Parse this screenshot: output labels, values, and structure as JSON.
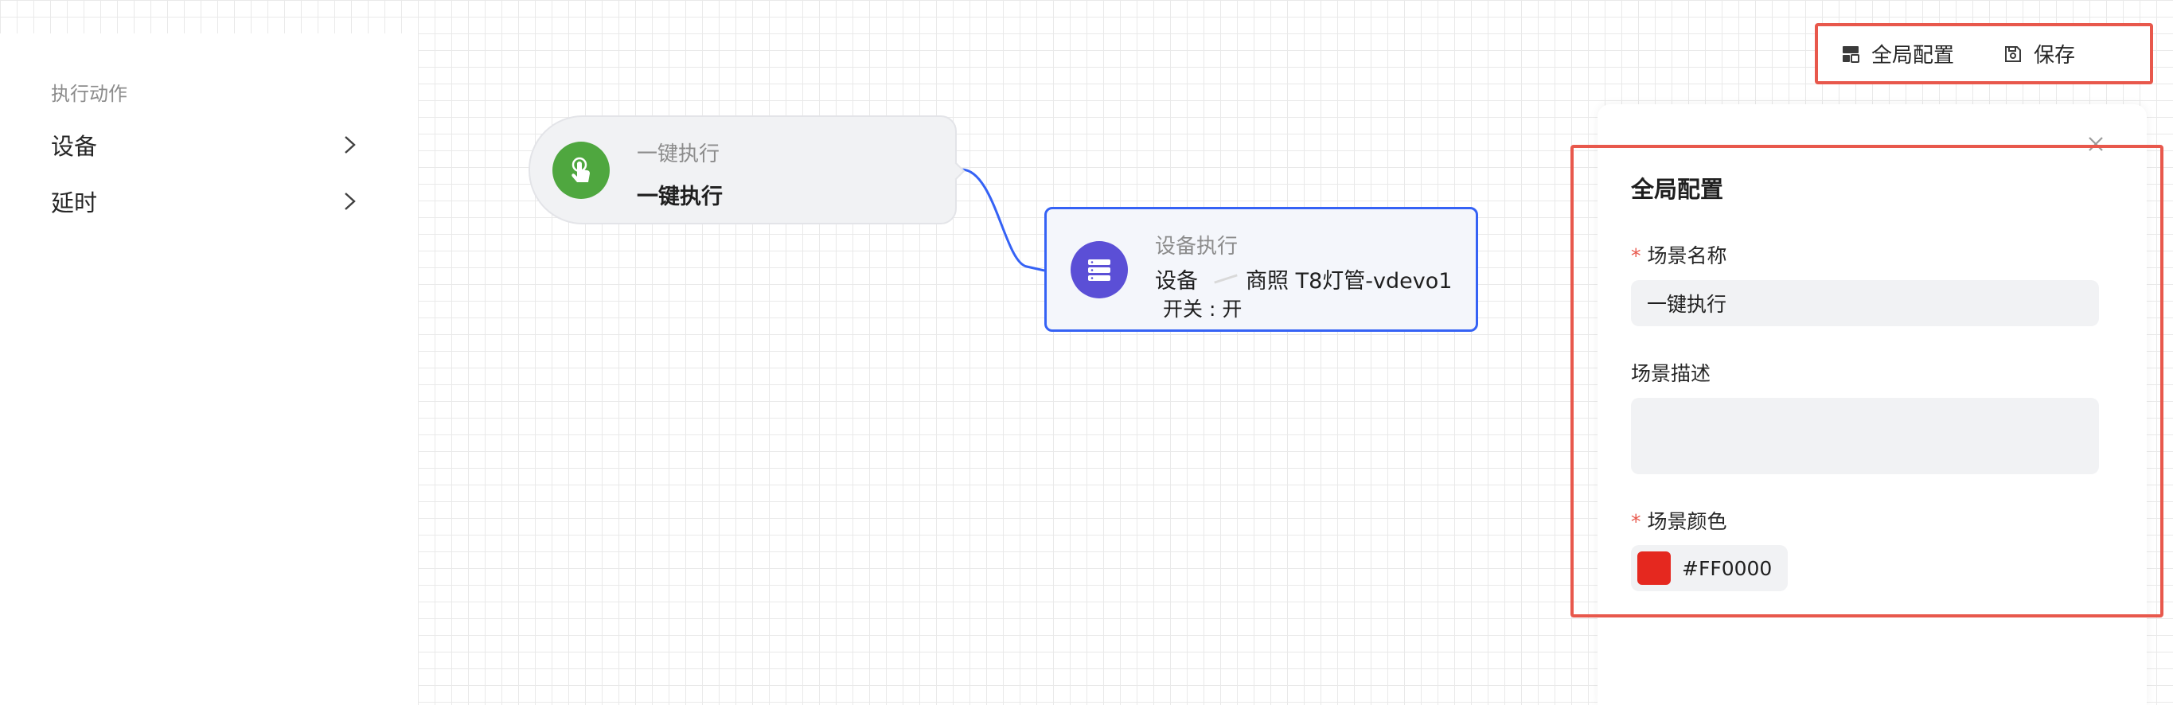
{
  "sidebar": {
    "section_title": "执行动作",
    "items": [
      {
        "label": "设备"
      },
      {
        "label": "延时"
      }
    ]
  },
  "canvas": {
    "trigger_node": {
      "subtitle": "一键执行",
      "title": "一键执行",
      "icon": "tap-hand-icon",
      "icon_color": "#4FA73F"
    },
    "device_node": {
      "subtitle": "设备执行",
      "device_prefix": "设备",
      "device_name": "商照 T8灯管-vdevo1",
      "action": "开关 : 开",
      "icon": "server-stack-icon",
      "icon_color": "#5B4FD6",
      "border_color": "#3562F5"
    }
  },
  "toolbar": {
    "global_config_label": "全局配置",
    "save_label": "保存"
  },
  "panel": {
    "title": "全局配置",
    "name_label": "场景名称",
    "name_value": "一键执行",
    "desc_label": "场景描述",
    "desc_value": "",
    "color_label": "场景颜色",
    "color_value": "#FF0000",
    "swatch_color": "#E5281F"
  },
  "colors": {
    "highlight_border": "#E8584C",
    "accent": "#3562F5"
  }
}
